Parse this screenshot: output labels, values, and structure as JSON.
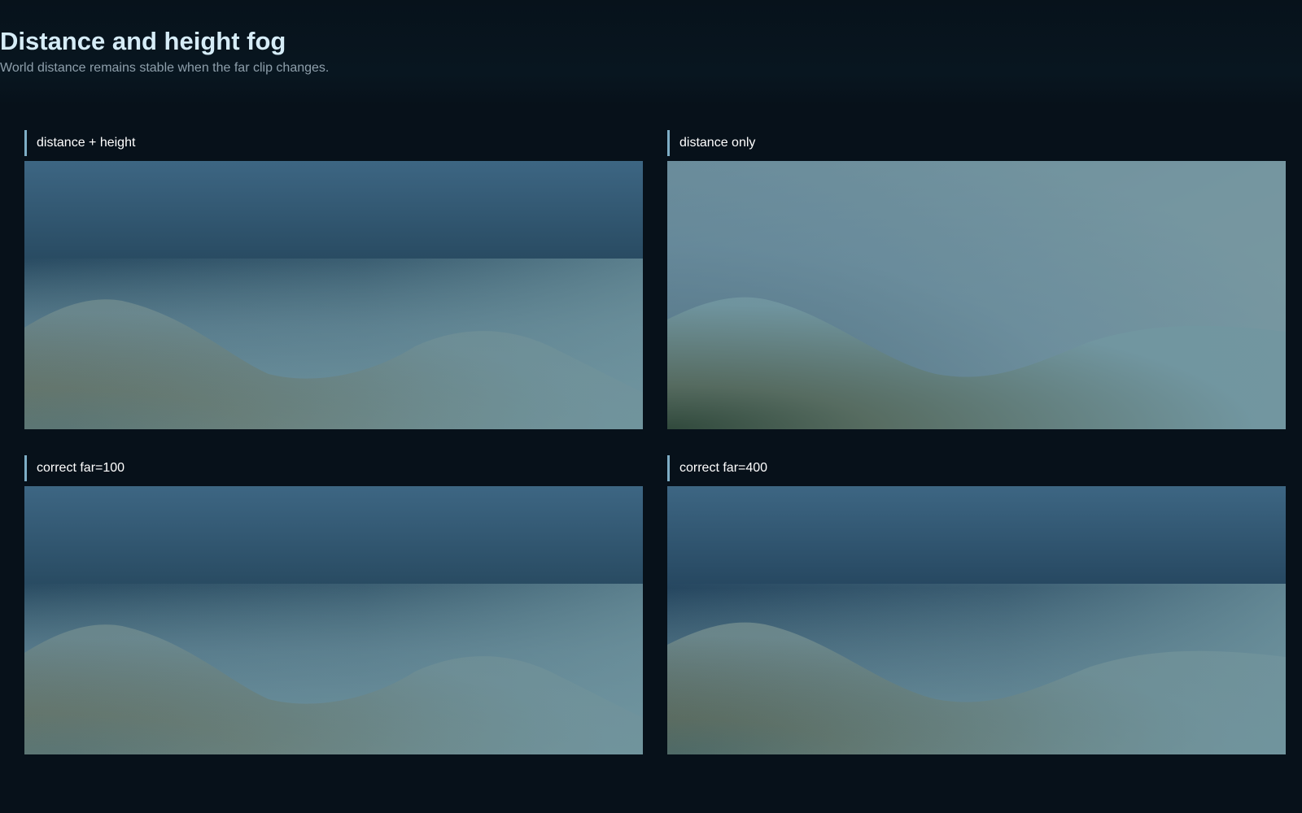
{
  "header": {
    "title": "Distance and height fog",
    "subtitle": "World distance remains stable when the far clip changes."
  },
  "panels": [
    {
      "label": "distance + height",
      "mode": "height"
    },
    {
      "label": "distance only",
      "mode": "distance"
    },
    {
      "label": "correct far=100",
      "mode": "height"
    },
    {
      "label": "correct far=400",
      "mode": "height-strong"
    }
  ],
  "colors": {
    "background": "#07111a",
    "accent_bar": "#7eaec6",
    "sky_top": "#3d6683",
    "sky_mid": "#284a61",
    "fog": "#7196a0",
    "terrain": "#5b5a3c"
  }
}
